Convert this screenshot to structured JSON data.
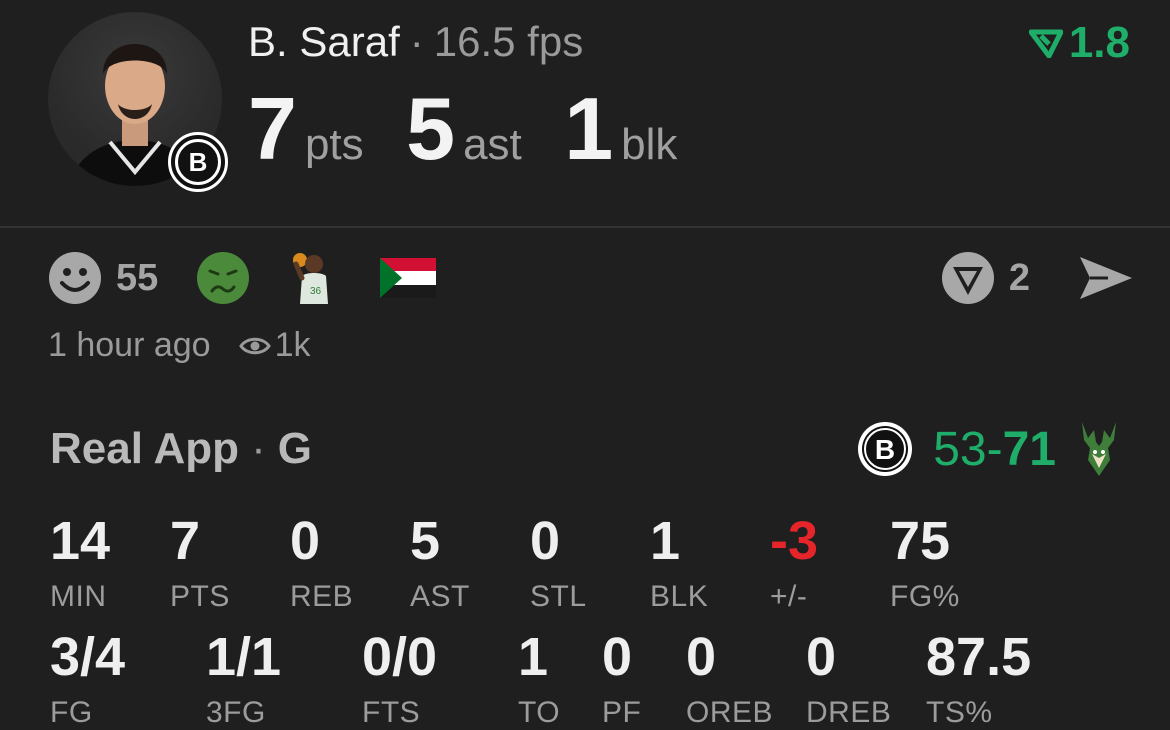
{
  "header": {
    "player_name": "B. Saraf",
    "separator": "·",
    "fps": "16.5 fps",
    "fps_change": "1.8",
    "colors": {
      "accent_green": "#1fae6a",
      "negative_red": "#e5252a"
    },
    "headline_stats": [
      {
        "value": "7",
        "unit": "pts"
      },
      {
        "value": "5",
        "unit": "ast"
      },
      {
        "value": "1",
        "unit": "blk"
      }
    ]
  },
  "reactions": {
    "smiley_count": "55",
    "vote_count": "2",
    "icons": [
      "smiley-icon",
      "sick-face-icon",
      "player-photo-icon",
      "sudan-flag-icon",
      "vote-icon",
      "send-icon"
    ]
  },
  "meta": {
    "time_ago": "1 hour ago",
    "views": "1k"
  },
  "game": {
    "app": "Real App",
    "separator": "·",
    "position": "G",
    "score_left": "53-",
    "score_right": "71"
  },
  "stats_row1": [
    {
      "value": "14",
      "label": "MIN"
    },
    {
      "value": "7",
      "label": "PTS"
    },
    {
      "value": "0",
      "label": "REB"
    },
    {
      "value": "5",
      "label": "AST"
    },
    {
      "value": "0",
      "label": "STL"
    },
    {
      "value": "1",
      "label": "BLK"
    },
    {
      "value": "-3",
      "label": "+/-"
    },
    {
      "value": "75",
      "label": "FG%"
    }
  ],
  "stats_row2": [
    {
      "value": "3/4",
      "label": "FG"
    },
    {
      "value": "1/1",
      "label": "3FG"
    },
    {
      "value": "0/0",
      "label": "FTS"
    },
    {
      "value": "1",
      "label": "TO"
    },
    {
      "value": "0",
      "label": "PF"
    },
    {
      "value": "0",
      "label": "OREB"
    },
    {
      "value": "0",
      "label": "DREB"
    },
    {
      "value": "87.5",
      "label": "TS%"
    }
  ]
}
